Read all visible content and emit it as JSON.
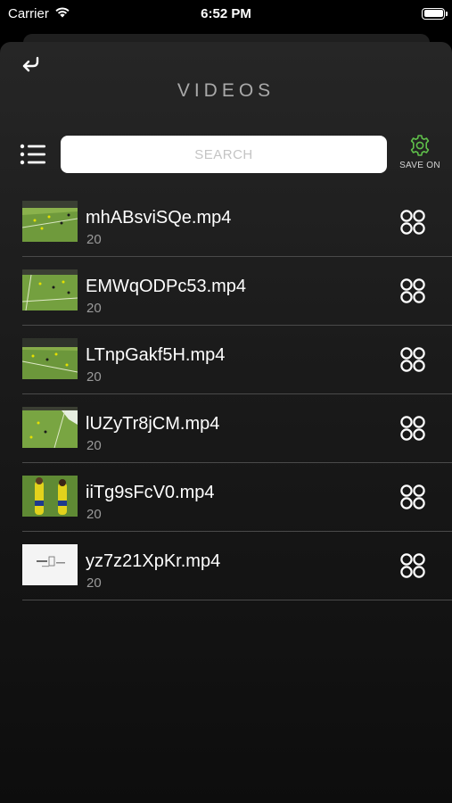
{
  "status_bar": {
    "carrier": "Carrier",
    "time": "6:52 PM"
  },
  "header": {
    "title": "VIDEOS"
  },
  "search": {
    "placeholder": "SEARCH"
  },
  "save_toggle": {
    "label": "SAVE ON",
    "icon": "gear-icon",
    "color": "#5fbf4a"
  },
  "videos": [
    {
      "name": "mhABsviSQe.mp4",
      "count": "20",
      "thumb": "soccer-field"
    },
    {
      "name": "EMWqODPc53.mp4",
      "count": "20",
      "thumb": "soccer-field"
    },
    {
      "name": "LTnpGakf5H.mp4",
      "count": "20",
      "thumb": "soccer-field"
    },
    {
      "name": "lUZyTr8jCM.mp4",
      "count": "20",
      "thumb": "soccer-field"
    },
    {
      "name": "iiTg9sFcV0.mp4",
      "count": "20",
      "thumb": "soccer-players"
    },
    {
      "name": "yz7z21XpKr.mp4",
      "count": "20",
      "thumb": "white-document"
    }
  ]
}
